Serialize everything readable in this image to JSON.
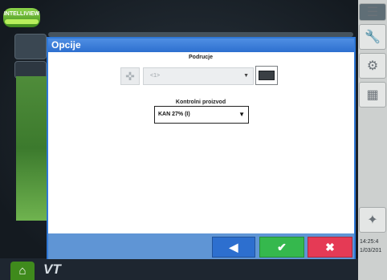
{
  "brand": {
    "logo_text": "INTELLIVIEW"
  },
  "dialog": {
    "title": "Opcije",
    "area": {
      "label": "Podrucje",
      "selected": "<1>"
    },
    "product": {
      "label": "Kontrolni proizvod",
      "selected": "KAN 27% (I)"
    },
    "buttons": {
      "back_icon": "◀",
      "ok_icon": "✔",
      "cancel_icon": "✖"
    }
  },
  "status": {
    "time": "14:25:4",
    "date": "1/03/201"
  },
  "bottom": {
    "vt_label": "VT"
  },
  "icons": {
    "side": [
      "menu-icon",
      "wrench-icon",
      "implement-icon",
      "table-icon",
      "gps-icon"
    ],
    "home": "home-icon"
  },
  "colors": {
    "title_bar": "#2d6fcf",
    "ok": "#35b84d",
    "cancel": "#e53a55",
    "back": "#2d6fcf"
  }
}
